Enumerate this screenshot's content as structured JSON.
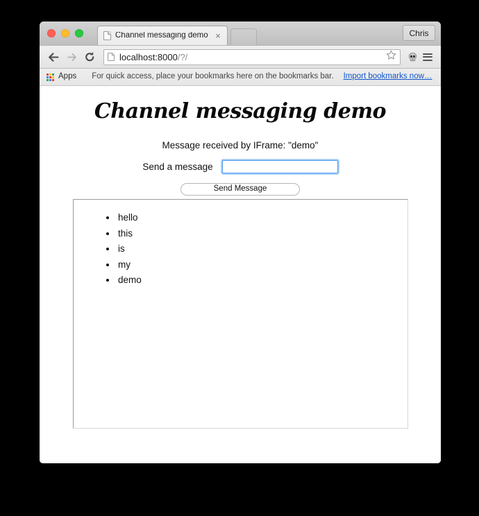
{
  "browser": {
    "tab": {
      "title": "Channel messaging demo",
      "close_label": "×",
      "favicon_name": "page-favicon"
    },
    "profile_label": "Chris",
    "toolbar": {
      "back_icon": "back-arrow-icon",
      "forward_icon": "forward-arrow-icon",
      "reload_icon": "reload-icon",
      "url_main": "localhost:8000",
      "url_path": "/?/",
      "bookmark_star_icon": "star-icon",
      "extension_icon": "skull-icon",
      "menu_icon": "hamburger-menu-icon"
    },
    "bookmarks_bar": {
      "apps_label": "Apps",
      "hint": "For quick access, place your bookmarks here on the bookmarks bar.",
      "import_link": "Import bookmarks now…"
    }
  },
  "page": {
    "title": "Channel messaging demo",
    "received_message": "Message received by IFrame: \"demo\"",
    "form": {
      "label": "Send a message",
      "input_value": "",
      "input_placeholder": "",
      "button_label": "Send Message"
    },
    "iframe_messages": [
      "hello",
      "this",
      "is",
      "my",
      "demo"
    ]
  },
  "colors": {
    "accent_focus": "#4a9bf0",
    "link": "#1155cc",
    "traffic_red": "#ff5f57",
    "traffic_yellow": "#febc2e",
    "traffic_green": "#28c840",
    "apps_dot_red": "#e8453c",
    "apps_dot_yellow": "#f5c131",
    "apps_dot_green": "#35a853",
    "apps_dot_blue": "#4285f4"
  }
}
